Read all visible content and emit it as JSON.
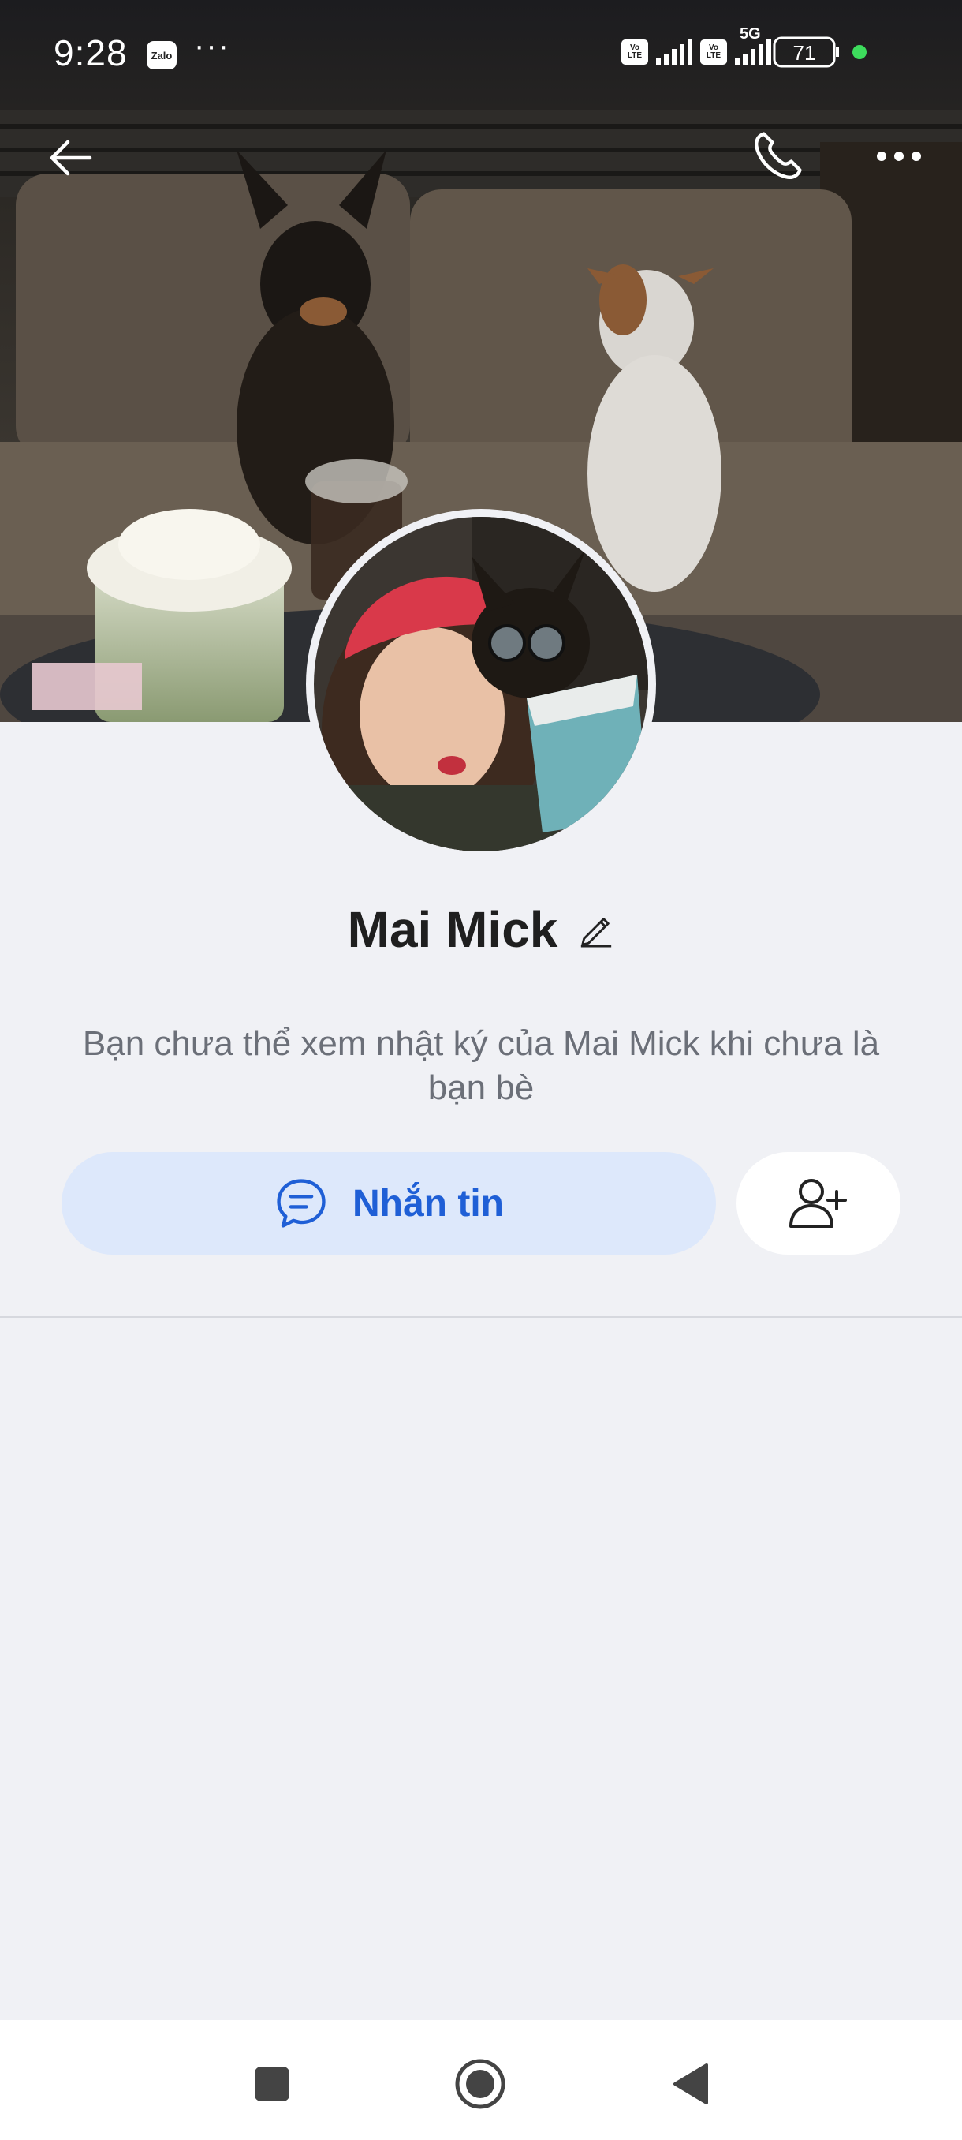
{
  "status_bar": {
    "time": "9:28",
    "app_badge": "Zalo",
    "more": "···",
    "volte_1": "Vo LTE",
    "volte_2": "Vo LTE",
    "network": "5G",
    "battery": "71"
  },
  "header": {
    "back_icon": "arrow-left-icon",
    "call_icon": "phone-icon",
    "more_icon": "more-horizontal-icon"
  },
  "profile": {
    "name": "Mai Mick",
    "notice": "Bạn chưa thể xem nhật ký của Mai Mick khi chưa là bạn bè"
  },
  "actions": {
    "message_label": "Nhắn tin",
    "message_icon": "chat-bubble-icon",
    "add_friend_icon": "add-user-icon"
  },
  "nav": {
    "recents": "square-icon",
    "home": "circle-icon",
    "back": "triangle-back-icon"
  },
  "colors": {
    "accent": "#1f5fd6",
    "message_button_bg": "#dde8fb",
    "background": "#f0f1f5",
    "battery_dot": "#3ddc5c"
  }
}
